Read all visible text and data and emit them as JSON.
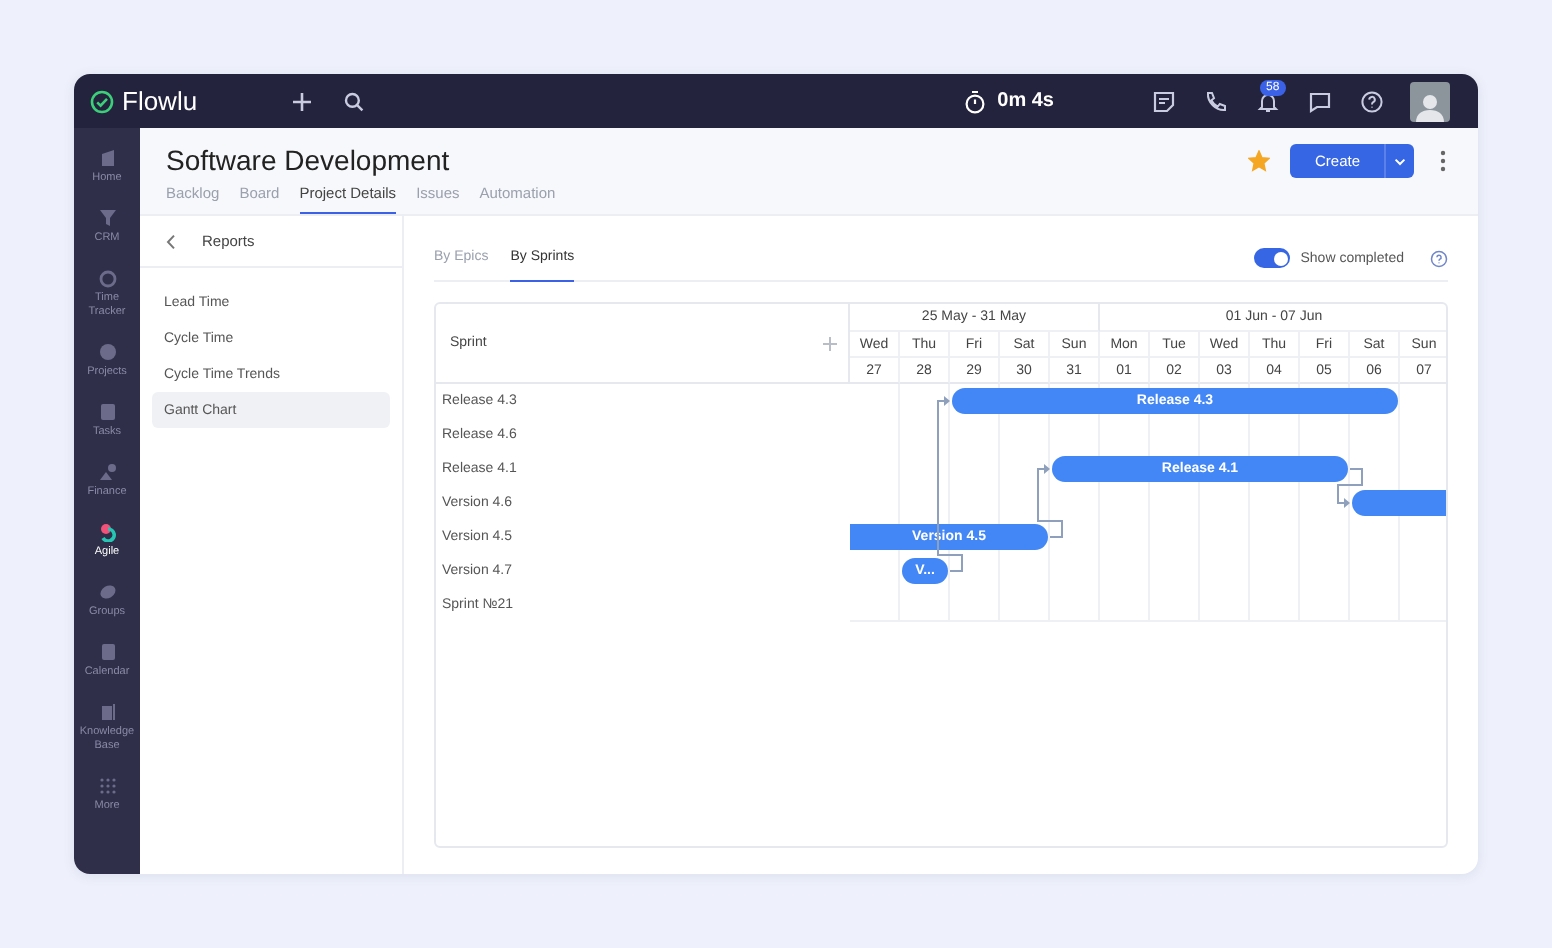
{
  "topbar": {
    "logo": "Flowlu",
    "timer": "0m 4s",
    "notifications_badge": "58"
  },
  "sidebar": {
    "items": [
      {
        "label": "Home",
        "selected": false
      },
      {
        "label": "CRM",
        "selected": false
      },
      {
        "label": "Time Tracker",
        "selected": false
      },
      {
        "label": "Projects",
        "selected": false
      },
      {
        "label": "Tasks",
        "selected": false
      },
      {
        "label": "Finance",
        "selected": false
      },
      {
        "label": "Agile",
        "selected": true
      },
      {
        "label": "Groups",
        "selected": false
      },
      {
        "label": "Calendar",
        "selected": false
      },
      {
        "label": "Knowledge Base",
        "selected": false
      },
      {
        "label": "More",
        "selected": false
      }
    ]
  },
  "header": {
    "title": "Software Development",
    "starred": true,
    "create_button": "Create",
    "tabs": [
      {
        "label": "Backlog",
        "selected": false
      },
      {
        "label": "Board",
        "selected": false
      },
      {
        "label": "Project Details",
        "selected": true
      },
      {
        "label": "Issues",
        "selected": false
      },
      {
        "label": "Automation",
        "selected": false
      }
    ]
  },
  "reports": {
    "title": "Reports",
    "items": [
      {
        "label": "Lead Time",
        "selected": false
      },
      {
        "label": "Cycle Time",
        "selected": false
      },
      {
        "label": "Cycle Time Trends",
        "selected": false
      },
      {
        "label": "Gantt Chart",
        "selected": true
      }
    ]
  },
  "view_tabs": [
    {
      "label": "By Epics",
      "selected": false
    },
    {
      "label": "By Sprints",
      "selected": true
    }
  ],
  "show_completed": {
    "label": "Show completed",
    "on": true
  },
  "gantt": {
    "column_title": "Sprint",
    "weeks": [
      {
        "label": "25 May - 31 May",
        "days": [
          {
            "day": "Wed",
            "date": "27"
          },
          {
            "day": "Thu",
            "date": "28"
          },
          {
            "day": "Fri",
            "date": "29"
          },
          {
            "day": "Sat",
            "date": "30"
          },
          {
            "day": "Sun",
            "date": "31"
          }
        ]
      },
      {
        "label": "01 Jun - 07 Jun",
        "days": [
          {
            "day": "Mon",
            "date": "01"
          },
          {
            "day": "Tue",
            "date": "02"
          },
          {
            "day": "Wed",
            "date": "03"
          },
          {
            "day": "Thu",
            "date": "04"
          },
          {
            "day": "Fri",
            "date": "05"
          },
          {
            "day": "Sat",
            "date": "06"
          },
          {
            "day": "Sun",
            "date": "07"
          }
        ]
      }
    ],
    "rows": [
      {
        "name": "Release 4.3",
        "bar": true,
        "bar_label": "Release 4.3"
      },
      {
        "name": "Release 4.6",
        "bar": false
      },
      {
        "name": "Release 4.1",
        "bar": true,
        "bar_label": "Release 4.1"
      },
      {
        "name": "Version 4.6",
        "bar": true
      },
      {
        "name": "Version 4.5",
        "bar": true,
        "bar_label": "Version 4.5"
      },
      {
        "name": "Version 4.7",
        "bar": true,
        "bar_label": "V..."
      },
      {
        "name": "Sprint №21",
        "bar": false
      }
    ]
  }
}
